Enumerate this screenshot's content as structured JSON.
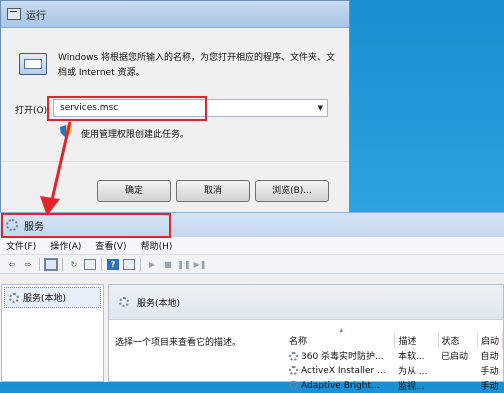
{
  "run_dialog": {
    "title": "运行",
    "description": "Windows 将根据您所输入的名称，为您打开相应的程序、文件夹、文档或 Internet 资源。",
    "open_label": "打开(O):",
    "open_value": "services.msc",
    "admin_note": "使用管理权限创建此任务。",
    "ok_label": "确定",
    "cancel_label": "取消",
    "browse_label": "浏览(B)...",
    "highlight_color": "#e0262c"
  },
  "services_window": {
    "title": "服务",
    "menu": [
      "文件(F)",
      "操作(A)",
      "查看(V)",
      "帮助(H)"
    ],
    "toolbar_icons": [
      "back-icon",
      "forward-icon",
      "show-hide-tree-icon",
      "refresh-icon",
      "export-icon",
      "help-icon",
      "properties-icon",
      "play-icon",
      "stop-icon",
      "pause-icon",
      "restart-icon"
    ],
    "tree_item": "服务(本地)",
    "panel_header": "服务(本地)",
    "panel_description": "选择一个项目来查看它的描述。",
    "columns": [
      "名称",
      "描述",
      "状态",
      "启动"
    ],
    "rows": [
      {
        "name": "360 杀毒实时防护...",
        "desc": "本软...",
        "status": "已启动",
        "startup": "自动"
      },
      {
        "name": "ActiveX Installer ...",
        "desc": "为从 ...",
        "status": "",
        "startup": "手动"
      },
      {
        "name": "Adaptive Bright...",
        "desc": "监视...",
        "status": "",
        "startup": "手动"
      }
    ]
  }
}
